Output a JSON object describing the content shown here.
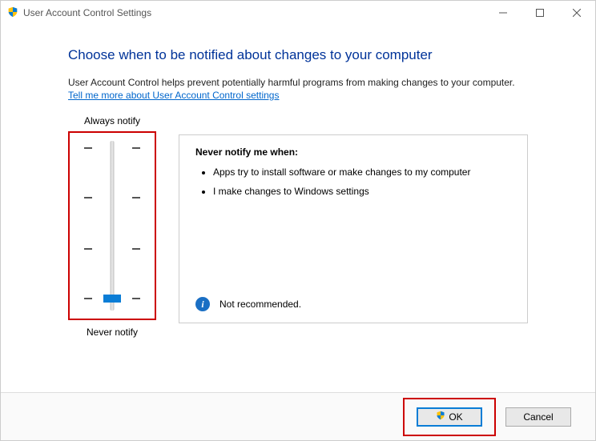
{
  "window": {
    "title": "User Account Control Settings"
  },
  "page": {
    "heading": "Choose when to be notified about changes to your computer",
    "desc": "User Account Control helps prevent potentially harmful programs from making changes to your computer.",
    "help_link": "Tell me more about User Account Control settings"
  },
  "slider": {
    "top_label": "Always notify",
    "bottom_label": "Never notify",
    "levels": 4,
    "current_level_index": 3
  },
  "info": {
    "heading": "Never notify me when:",
    "bullets": [
      "Apps try to install software or make changes to my computer",
      "I make changes to Windows settings"
    ],
    "recommendation": "Not recommended."
  },
  "buttons": {
    "ok": "OK",
    "cancel": "Cancel"
  }
}
